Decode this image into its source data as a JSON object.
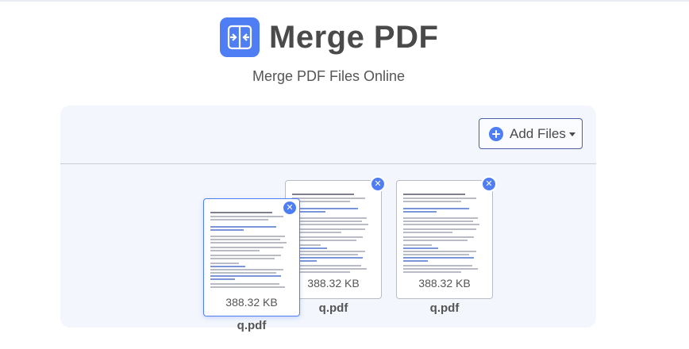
{
  "header": {
    "title": "Merge PDF",
    "subtitle": "Merge PDF Files Online",
    "logo_icon": "merge-arrows-icon",
    "accent_color": "#4f7df3"
  },
  "toolbar": {
    "add_files_label": "Add Files",
    "add_icon": "plus-circle-icon",
    "dropdown_icon": "caret-down-icon"
  },
  "files": [
    {
      "name": "q.pdf",
      "size": "388.32 KB",
      "state": "dragging"
    },
    {
      "name": "q.pdf",
      "size": "388.32 KB",
      "state": "normal"
    },
    {
      "name": "q.pdf",
      "size": "388.32 KB",
      "state": "normal"
    }
  ],
  "remove_icon": "close-icon"
}
